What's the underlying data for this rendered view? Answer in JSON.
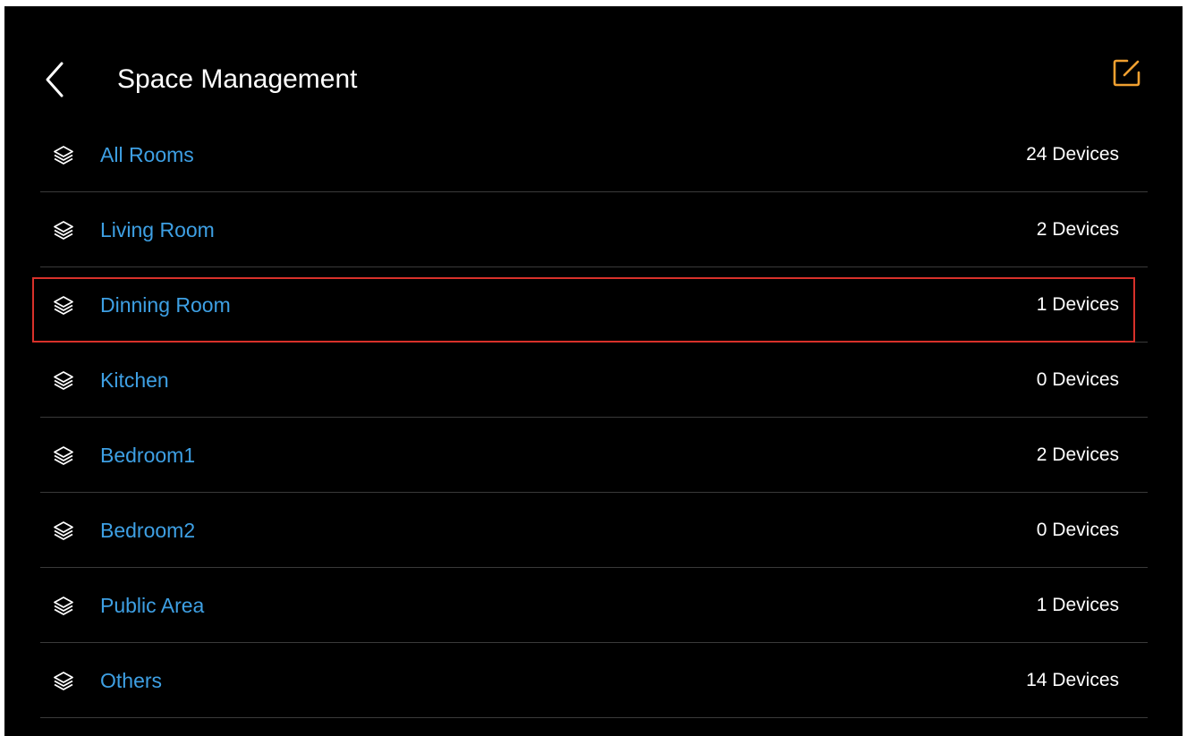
{
  "header": {
    "title": "Space Management",
    "back_icon": "chevron-left-icon",
    "edit_icon": "edit-square-icon"
  },
  "colors": {
    "background": "#000000",
    "room_name": "#3ea0e4",
    "accent_edit": "#f0a030",
    "highlight_border": "#d8312a",
    "divider": "#3a3a3a"
  },
  "rooms": [
    {
      "name": "All Rooms",
      "count": "24 Devices",
      "icon": "layers-icon"
    },
    {
      "name": "Living Room",
      "count": "2 Devices",
      "icon": "layers-icon"
    },
    {
      "name": "Dinning Room",
      "count": "1 Devices",
      "icon": "layers-icon",
      "highlighted": true
    },
    {
      "name": "Kitchen",
      "count": "0 Devices",
      "icon": "layers-icon"
    },
    {
      "name": "Bedroom1",
      "count": "2 Devices",
      "icon": "layers-icon"
    },
    {
      "name": "Bedroom2",
      "count": "0 Devices",
      "icon": "layers-icon"
    },
    {
      "name": "Public Area",
      "count": "1 Devices",
      "icon": "layers-icon"
    },
    {
      "name": "Others",
      "count": "14 Devices",
      "icon": "layers-icon"
    }
  ]
}
